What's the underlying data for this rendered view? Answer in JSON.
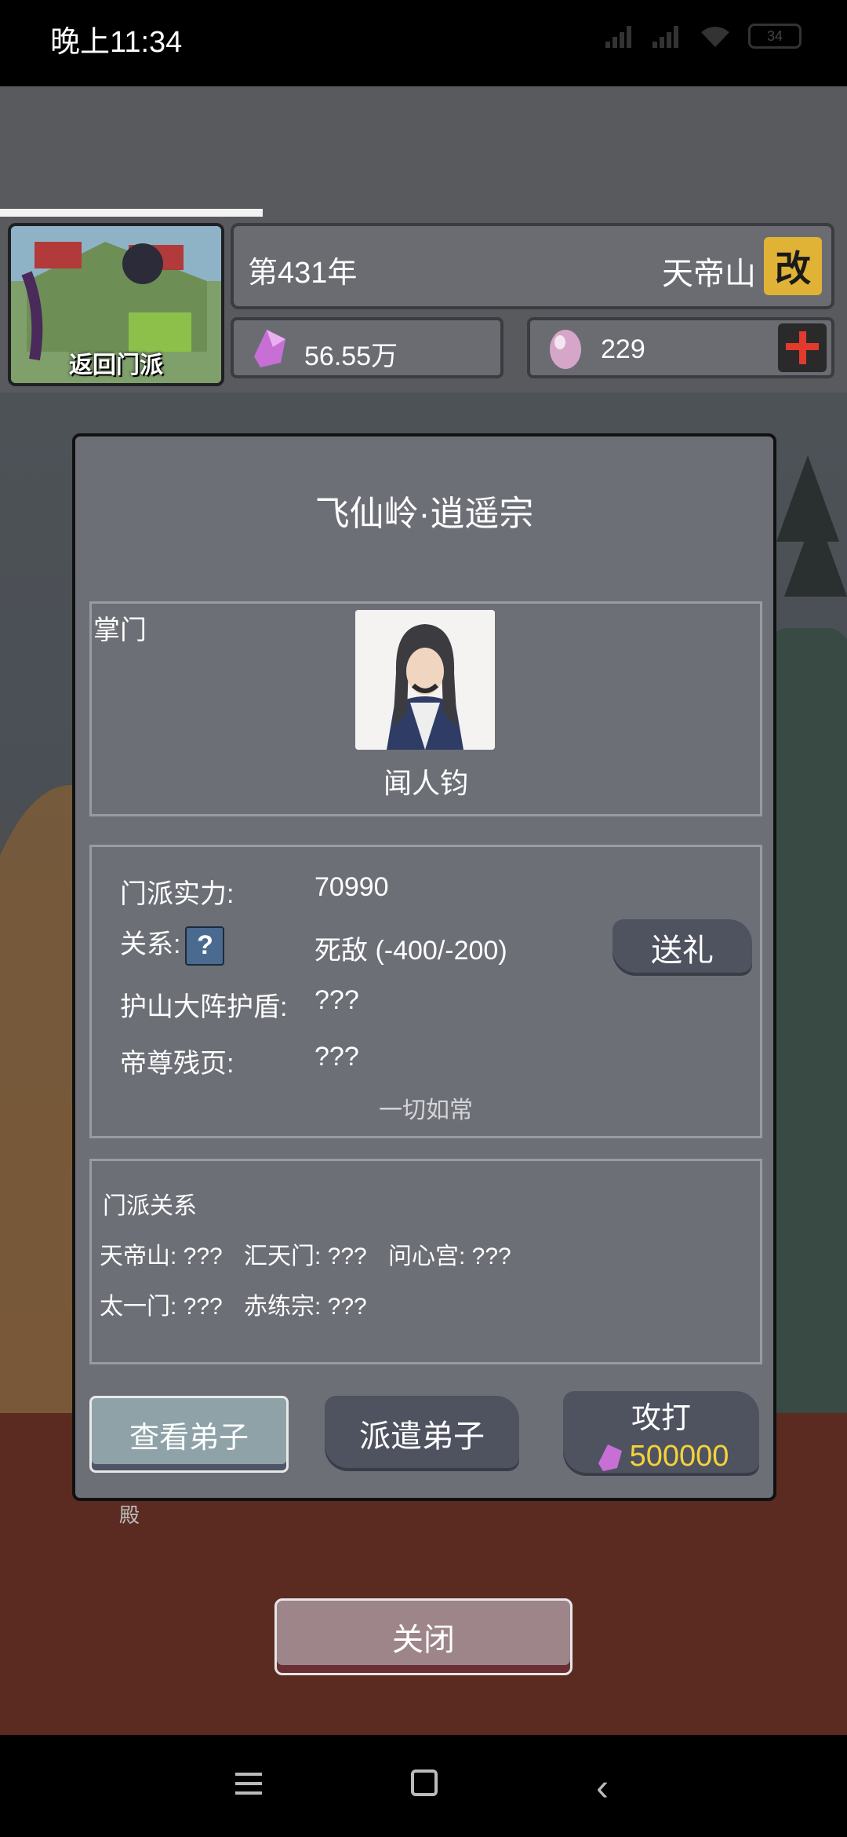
{
  "status_bar": {
    "time": "晚上11:34",
    "battery": "34"
  },
  "header": {
    "progress": 0.31,
    "sect_thumbnail_label": "返回门派",
    "year": "第431年",
    "location": "天帝山",
    "rename_label": "改",
    "spirit_stones": "56.55万",
    "eggs": "229"
  },
  "scene": {
    "label": "殿"
  },
  "dialog": {
    "title": "飞仙岭·逍遥宗",
    "leader": {
      "label": "掌门",
      "name": "闻人钧"
    },
    "info": {
      "strength_label": "门派实力:",
      "strength_value": "70990",
      "relation_label": "关系:",
      "relation_help": "?",
      "relation_value": "死敌  (-400/-200)",
      "shield_label": "护山大阵护盾:",
      "shield_value": "???",
      "pages_label": "帝尊残页:",
      "pages_value": "???",
      "status_note": "一切如常",
      "gift_button": "送礼"
    },
    "relations": {
      "title": "门派关系",
      "items": [
        {
          "label": "天帝山: ???"
        },
        {
          "label": "汇天门: ???"
        },
        {
          "label": "问心宫: ???"
        },
        {
          "label": "太一门: ???"
        },
        {
          "label": "赤练宗: ???"
        }
      ]
    },
    "buttons": {
      "view_disciples": "查看弟子",
      "dispatch_disciples": "派遣弟子",
      "attack": "攻打",
      "attack_cost": "500000"
    }
  },
  "close_button": "关闭",
  "colors": {
    "accent_gold": "#e0b236",
    "cost_yellow": "#f4d23b",
    "plus_red": "#e23b2e"
  }
}
